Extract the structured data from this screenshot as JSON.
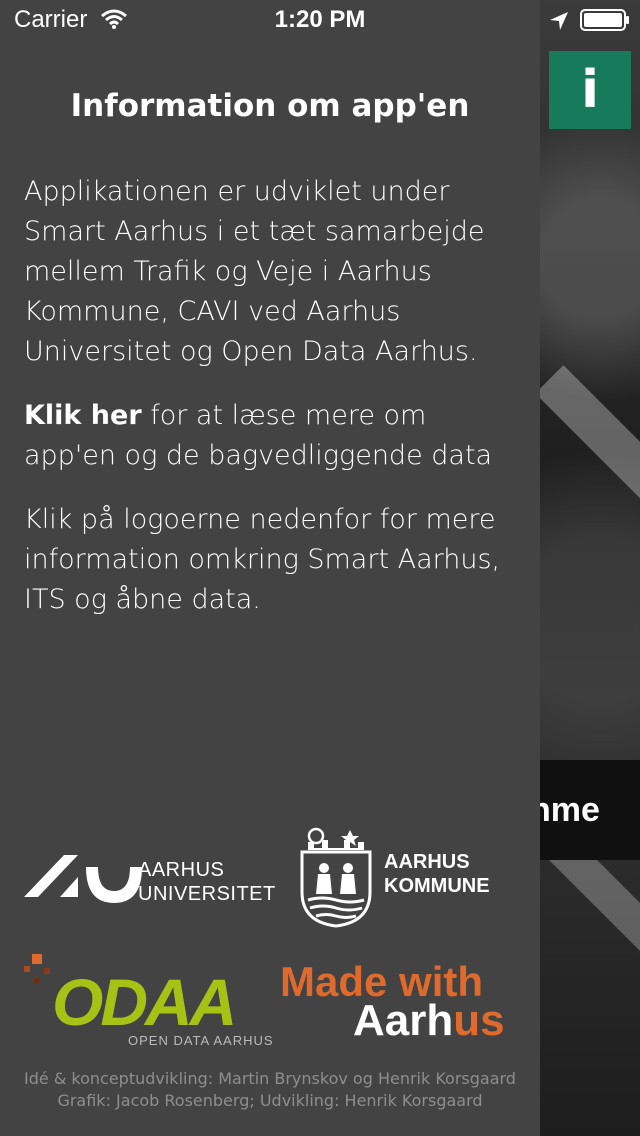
{
  "status_bar": {
    "carrier": "Carrier",
    "time": "1:20 PM"
  },
  "info_button": {
    "label": "i",
    "color": "#177a5a"
  },
  "background": {
    "banner_text": "nme"
  },
  "panel": {
    "title": "Information om app'en",
    "paragraph1": "Applikationen er udviklet under Smart Aarhus i et tæt samarbejde mellem Trafik og Veje i Aarhus Kommune, CAVI ved Aarhus Universitet og Open Data Aarhus.",
    "paragraph2_link": "Klik her",
    "paragraph2_rest": " for at læse mere om app'en og de bagvedliggende data",
    "paragraph3": "Klik på logoerne nedenfor for mere information omkring Smart Aarhus, ITS og åbne data."
  },
  "logos": {
    "aarhus_universitet": {
      "line1": "AARHUS",
      "line2": "UNIVERSITET"
    },
    "aarhus_kommune": {
      "line1": "AARHUS",
      "line2": "KOMMUNE"
    },
    "odaa": {
      "word": "ODAA",
      "subtitle": "OPEN DATA AARHUS"
    },
    "made_with_aarhus": {
      "line1": "Made with",
      "line2_white": "Aarh",
      "line2_orange": "us"
    }
  },
  "credits": {
    "line1": "Idé & konceptudvikling: Martin Brynskov og Henrik Korsgaard",
    "line2": "Grafik: Jacob Rosenberg; Udvikling: Henrik Korsgaard"
  }
}
